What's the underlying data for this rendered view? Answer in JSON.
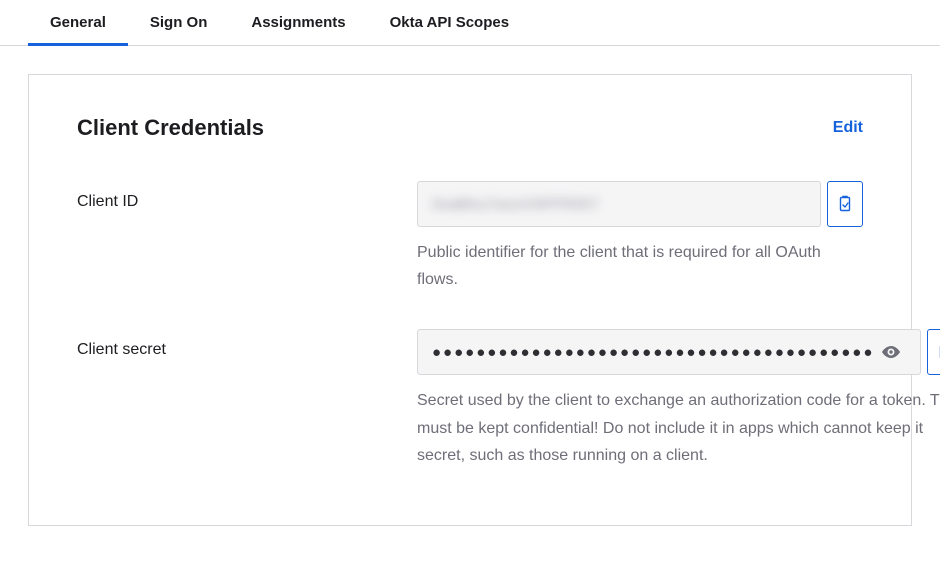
{
  "tabs": {
    "general": "General",
    "signon": "Sign On",
    "assignments": "Assignments",
    "scopes": "Okta API Scopes"
  },
  "panel": {
    "title": "Client Credentials",
    "edit": "Edit"
  },
  "fields": {
    "client_id": {
      "label": "Client ID",
      "value": "0oaBlnu7wxoVNPPR0h7",
      "help": "Public identifier for the client that is required for all OAuth flows."
    },
    "client_secret": {
      "label": "Client secret",
      "masked": "●●●●●●●●●●●●●●●●●●●●●●●●●●●●●●●●●●●●●●●●",
      "help": "Secret used by the client to exchange an authorization code for a token. This must be kept confidential! Do not include it in apps which cannot keep it secret, such as those running on a client."
    }
  }
}
